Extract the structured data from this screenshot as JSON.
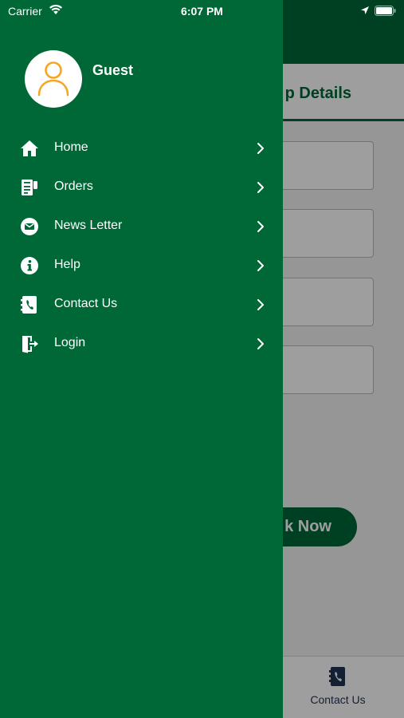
{
  "status_bar": {
    "carrier": "Carrier",
    "time": "6:07 PM"
  },
  "drawer": {
    "profile": {
      "name": "Guest"
    },
    "menu": [
      {
        "label": "Home",
        "icon": "home-icon"
      },
      {
        "label": "Orders",
        "icon": "orders-icon"
      },
      {
        "label": "News Letter",
        "icon": "newsletter-icon"
      },
      {
        "label": "Help",
        "icon": "info-icon"
      },
      {
        "label": "Contact Us",
        "icon": "phone-book-icon"
      },
      {
        "label": "Login",
        "icon": "login-icon"
      }
    ]
  },
  "background_page": {
    "header_title_partial": "p Details",
    "book_button_partial": "k Now",
    "tab_bar": {
      "contact_label": "Contact Us",
      "contact_icon": "phone-book-icon"
    }
  },
  "colors": {
    "primary": "#006837",
    "accent_avatar": "#f5a623",
    "tab_icon": "#1f3555"
  }
}
